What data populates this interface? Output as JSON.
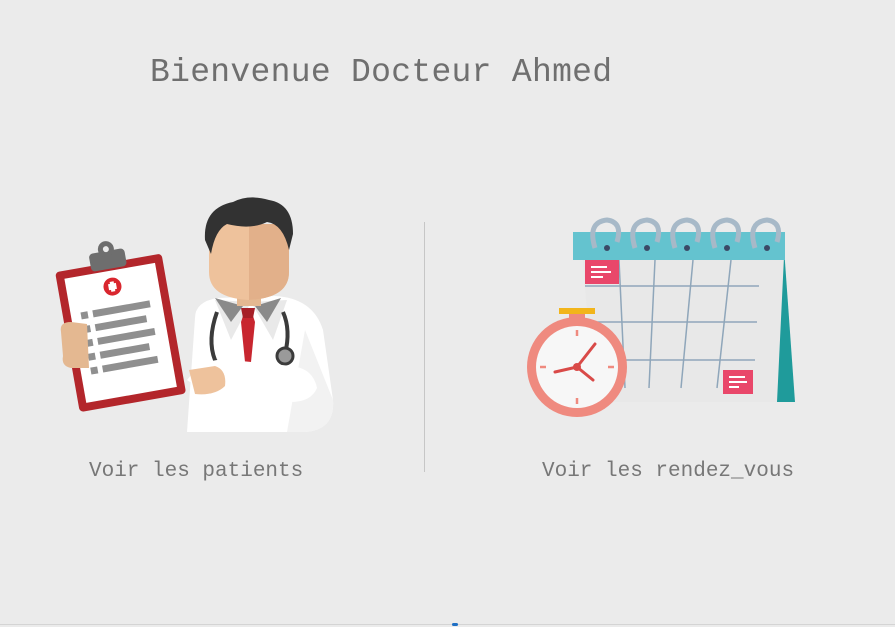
{
  "header": {
    "title": "Bienvenue Docteur Ahmed"
  },
  "cards": {
    "patients": {
      "label": "Voir les patients",
      "icon": "doctor-clipboard-icon"
    },
    "rendez_vous": {
      "label": "Voir les rendez_vous",
      "icon": "calendar-clock-icon"
    }
  },
  "colors": {
    "background": "#ebebeb",
    "title_text": "#6f6f6f",
    "label_text": "#777777",
    "clipboard_red": "#b3262b",
    "calendar_teal": "#5fc0cc",
    "clock_coral": "#ef8a7f"
  }
}
